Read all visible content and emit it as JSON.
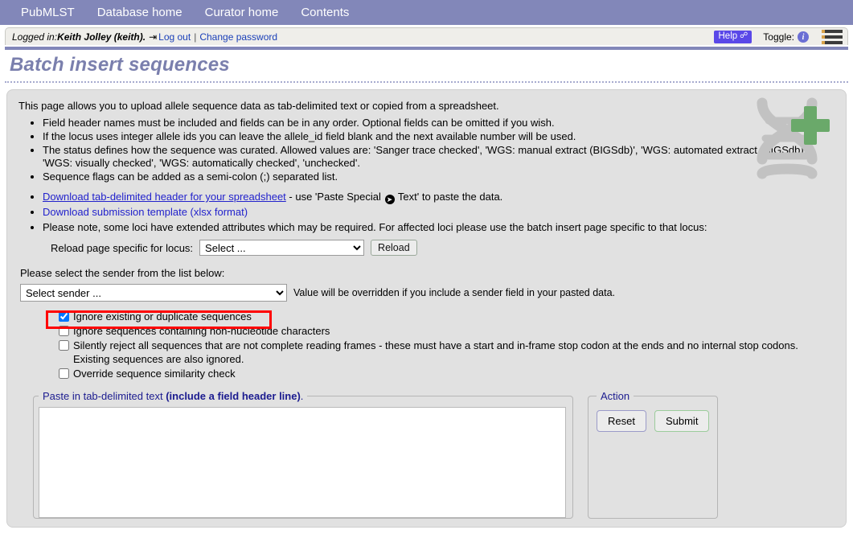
{
  "nav": {
    "items": [
      {
        "label": "PubMLST",
        "name": "nav-pubmlst"
      },
      {
        "label": "Database home",
        "name": "nav-database-home"
      },
      {
        "label": "Curator home",
        "name": "nav-curator-home"
      },
      {
        "label": "Contents",
        "name": "nav-contents"
      }
    ]
  },
  "login": {
    "prefix": "Logged in: ",
    "user": "Keith Jolley (keith).",
    "logout_label": "Log out",
    "separator": "|",
    "change_password_label": "Change password",
    "help_label": "Help",
    "toggle_label": "Toggle:",
    "info_glyph": "i"
  },
  "page": {
    "title": "Batch insert sequences",
    "intro": "This page allows you to upload allele sequence data as tab-delimited text or copied from a spreadsheet."
  },
  "bullets": [
    "Field header names must be included and fields can be in any order. Optional fields can be omitted if you wish.",
    "If the locus uses integer allele ids you can leave the allele_id field blank and the next available number will be used.",
    "The status defines how the sequence was curated. Allowed values are: 'Sanger trace checked', 'WGS: manual extract (BIGSdb)', 'WGS: automated extract (BIGSdb)', 'WGS: visually checked', 'WGS: automatically checked', 'unchecked'.",
    "Sequence flags can be added as a semi-colon (;) separated list."
  ],
  "links": {
    "header_link": "Download tab-delimited header for your spreadsheet",
    "header_suffix_pre": " - use 'Paste Special ",
    "header_suffix_post": " Text' to paste the data.",
    "template_link": "Download submission template (xlsx format)",
    "highlight_color": "#ff0000"
  },
  "extended_note": "Please note, some loci have extended attributes which may be required. For affected loci please use the batch insert page specific to that locus:",
  "reload_row": {
    "label": "Reload page specific for locus:",
    "select_value": "Select ...",
    "button_label": "Reload"
  },
  "sender": {
    "prompt": "Please select the sender from the list below:",
    "select_value": "Select sender ...",
    "note": "Value will be overridden if you include a sender field in your pasted data."
  },
  "checkboxes": [
    {
      "label": "Ignore existing or duplicate sequences",
      "checked": true
    },
    {
      "label": "Ignore sequences containing non-nucleotide characters",
      "checked": false
    },
    {
      "label": "Silently reject all sequences that are not complete reading frames - these must have a start and in-frame stop codon at the ends and no internal stop codons. Existing sequences are also ignored.",
      "checked": false
    },
    {
      "label": "Override sequence similarity check",
      "checked": false
    }
  ],
  "paste_fieldset": {
    "legend_plain": "Paste in tab-delimited text ",
    "legend_bold": "(include a field header line)",
    "legend_suffix": ".",
    "textarea_value": "",
    "textarea_placeholder": ""
  },
  "action_fieldset": {
    "legend": "Action",
    "reset_label": "Reset",
    "submit_label": "Submit"
  },
  "colors": {
    "nav_bg": "#8287b9",
    "title_text": "#7a7fad",
    "content_bg": "#e1e1e1",
    "help_bg": "#5a48e8",
    "link": "#2222cc",
    "legend": "#1b1b8f",
    "dna_gray": "#c2c2c2",
    "dna_plus_green": "#6aa96a"
  }
}
